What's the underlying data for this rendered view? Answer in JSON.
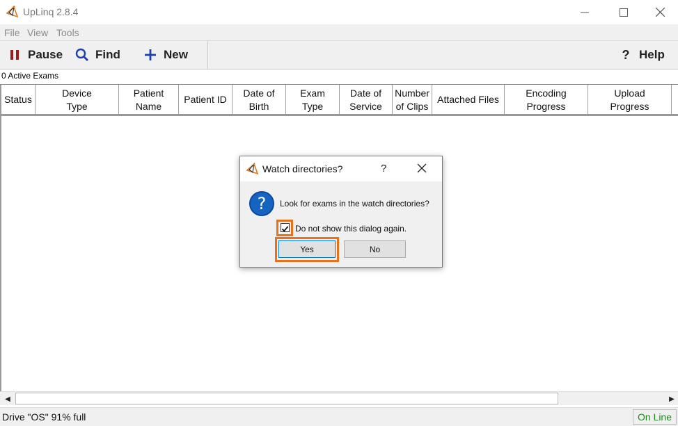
{
  "app": {
    "title": "UpLinq 2.8.4"
  },
  "menu": {
    "items": [
      "File",
      "View",
      "Tools"
    ]
  },
  "toolbar": {
    "pause_label": "Pause",
    "find_label": "Find",
    "new_label": "New",
    "help_label": "Help",
    "help_glyph": "?"
  },
  "exams": {
    "active_count_text": "0 Active Exams"
  },
  "table": {
    "columns": [
      "Status",
      "Device\nType",
      "Patient\nName",
      "Patient ID",
      "Date of\nBirth",
      "Exam\nType",
      "Date of\nService",
      "Number\nof Clips",
      "Attached Files",
      "Encoding\nProgress",
      "Upload\nProgress"
    ]
  },
  "scrollbar": {
    "left_arrow": "◀",
    "right_arrow": "▶"
  },
  "status": {
    "drive_text": "Drive \"OS\" 91% full",
    "connection": "On Line"
  },
  "dialog": {
    "title": "Watch directories?",
    "help_glyph": "?",
    "icon_glyph": "?",
    "message": "Look for exams in the watch directories?",
    "checkbox_label": "Do not show this dialog again.",
    "checkbox_checked": true,
    "yes_label": "Yes",
    "no_label": "No"
  },
  "colors": {
    "highlight": "#e9711c",
    "online": "#1a8a1a",
    "question_icon": "#1565c0",
    "pause_icon": "#9b1b1b",
    "toolbar_icons": "#1e40af"
  },
  "icons": {
    "app": "upLinq-logo-icon",
    "pause": "pause-icon",
    "find": "search-icon",
    "new": "plus-icon",
    "help": "help-icon",
    "question": "question-icon"
  }
}
